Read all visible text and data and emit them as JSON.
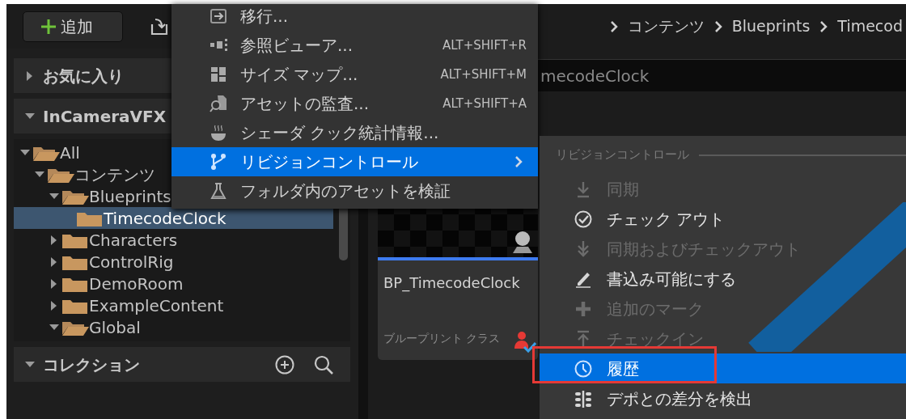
{
  "toolbar": {
    "add_button": "追加"
  },
  "breadcrumb": [
    "コンテンツ",
    "Blueprints",
    "Timecod"
  ],
  "sidebar": {
    "favorites": {
      "title": "お気に入り",
      "expanded": false
    },
    "project": {
      "title": "InCameraVFX",
      "expanded": true,
      "tree": [
        {
          "label": "All",
          "expanded": true,
          "selected": false,
          "children": [
            {
              "label": "コンテンツ",
              "expanded": true,
              "selected": false,
              "children": [
                {
                  "label": "Blueprints",
                  "expanded": true,
                  "selected": false,
                  "children": [
                    {
                      "label": "TimecodeClock",
                      "selected": true
                    }
                  ]
                },
                {
                  "label": "Characters",
                  "expanded": false,
                  "selected": false
                },
                {
                  "label": "ControlRig",
                  "expanded": false,
                  "selected": false
                },
                {
                  "label": "DemoRoom",
                  "expanded": false,
                  "selected": false
                },
                {
                  "label": "ExampleContent",
                  "expanded": false,
                  "selected": false
                },
                {
                  "label": "Global",
                  "expanded": true,
                  "selected": false
                }
              ]
            }
          ]
        }
      ]
    },
    "collections": {
      "title": "コレクション",
      "expanded": true
    }
  },
  "search": {
    "value": "mecodeClock"
  },
  "asset": {
    "name": "BP_TimecodeClock",
    "type": "ブループリント クラス"
  },
  "context_menu": {
    "items": [
      {
        "label": "移行...",
        "selected": false,
        "submenu": false
      },
      {
        "label": "参照ビューア...",
        "shortcut": "ALT+SHIFT+R",
        "selected": false,
        "submenu": false
      },
      {
        "label": "サイズ マップ...",
        "shortcut": "ALT+SHIFT+M",
        "selected": false,
        "submenu": false
      },
      {
        "label": "アセットの監査...",
        "shortcut": "ALT+SHIFT+A",
        "selected": false,
        "submenu": false
      },
      {
        "label": "シェーダ クック統計情報...",
        "selected": false,
        "submenu": false
      },
      {
        "label": "リビジョンコントロール",
        "selected": true,
        "submenu": true
      },
      {
        "label": "フォルダ内のアセットを検証",
        "selected": false,
        "submenu": false
      }
    ]
  },
  "submenu": {
    "header": "リビジョンコントロール",
    "items": [
      {
        "label": "同期",
        "disabled": true,
        "selected": false,
        "annotated": false
      },
      {
        "label": "チェック アウト",
        "disabled": false,
        "selected": false,
        "annotated": false
      },
      {
        "label": "同期およびチェックアウト",
        "disabled": true,
        "selected": false,
        "annotated": false
      },
      {
        "label": "書込み可能にする",
        "disabled": false,
        "selected": false,
        "annotated": false
      },
      {
        "label": "追加のマーク",
        "disabled": true,
        "selected": false,
        "annotated": false
      },
      {
        "label": "チェックイン",
        "disabled": true,
        "selected": false,
        "annotated": false
      },
      {
        "label": "履歴",
        "disabled": false,
        "selected": true,
        "annotated": true
      },
      {
        "label": "デポとの差分を検出",
        "disabled": false,
        "selected": false,
        "annotated": false
      }
    ]
  }
}
